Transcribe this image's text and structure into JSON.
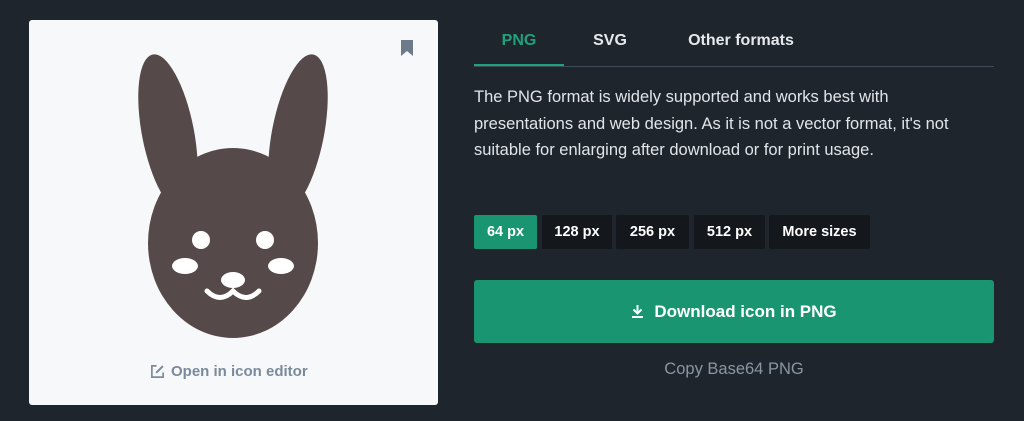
{
  "colors": {
    "accent": "#1a9571",
    "icon_fill": "#554949"
  },
  "preview": {
    "bookmark_icon": "bookmark-icon",
    "icon_name": "bunny-face-icon",
    "editor_link": {
      "icon": "edit-icon",
      "label": "Open in icon editor"
    }
  },
  "tabs": [
    {
      "label": "PNG",
      "active": true
    },
    {
      "label": "SVG",
      "active": false
    },
    {
      "label": "Other formats",
      "active": false
    }
  ],
  "description": "The PNG format is widely supported and works best with presentations and web design. As it is not a vector format, it's not suitable for enlarging after download or for print usage.",
  "sizes": [
    {
      "label": "64 px",
      "active": true
    },
    {
      "label": "128 px",
      "active": false
    },
    {
      "label": "256 px",
      "active": false
    },
    {
      "label": "512 px",
      "active": false
    },
    {
      "label": "More sizes",
      "active": false
    }
  ],
  "download": {
    "icon": "download-icon",
    "label": "Download icon in PNG"
  },
  "copy_base64": "Copy Base64 PNG"
}
